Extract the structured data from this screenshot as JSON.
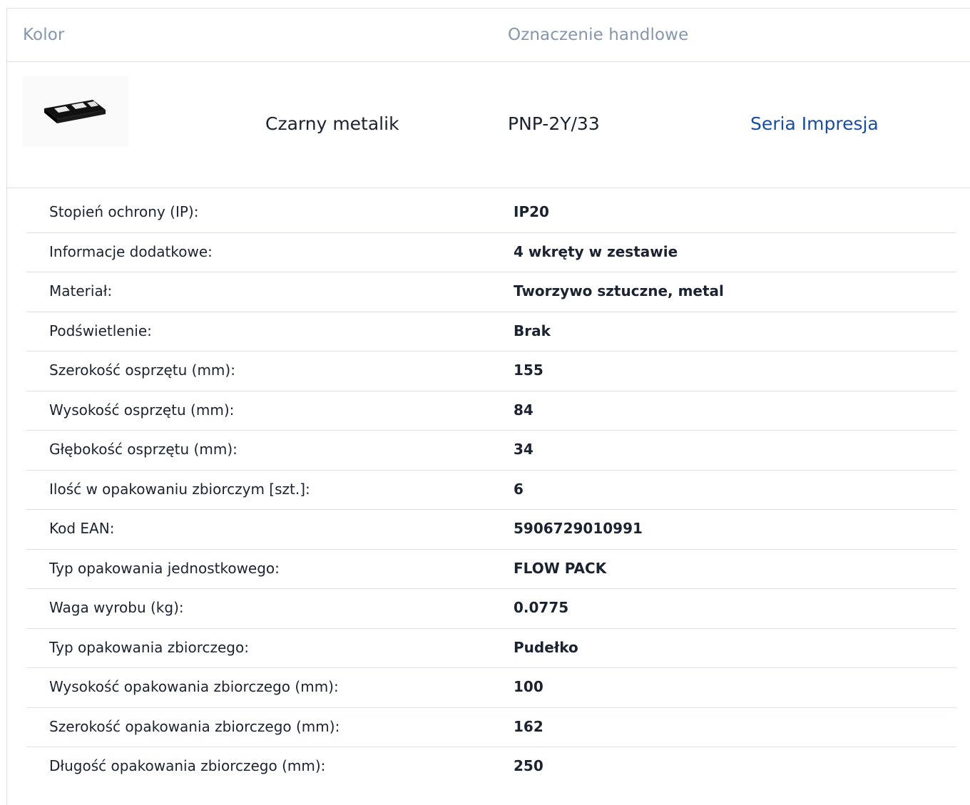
{
  "table": {
    "headers": {
      "color": "Kolor",
      "trade_name": "Oznaczenie handlowe"
    },
    "product": {
      "image_icon": "frame-product-image",
      "color": "Czarny metalik",
      "trade_name": "PNP-2Y/33",
      "series_link": "Seria Impresja"
    }
  },
  "specs": [
    {
      "label": "Stopień ochrony (IP):",
      "value": "IP20"
    },
    {
      "label": "Informacje dodatkowe:",
      "value": "4 wkręty w zestawie"
    },
    {
      "label": "Materiał:",
      "value": "Tworzywo sztuczne, metal"
    },
    {
      "label": "Podświetlenie:",
      "value": "Brak"
    },
    {
      "label": "Szerokość osprzętu (mm):",
      "value": "155"
    },
    {
      "label": "Wysokość osprzętu (mm):",
      "value": "84"
    },
    {
      "label": "Głębokość osprzętu (mm):",
      "value": "34"
    },
    {
      "label": "Ilość w opakowaniu zbiorczym [szt.]:",
      "value": "6"
    },
    {
      "label": "Kod EAN:",
      "value": "5906729010991"
    },
    {
      "label": "Typ opakowania jednostkowego:",
      "value": "FLOW PACK"
    },
    {
      "label": "Waga wyrobu (kg):",
      "value": "0.0775"
    },
    {
      "label": "Typ opakowania zbiorczego:",
      "value": "Pudełko"
    },
    {
      "label": "Wysokość opakowania zbiorczego (mm):",
      "value": "100"
    },
    {
      "label": "Szerokość opakowania zbiorczego (mm):",
      "value": "162"
    },
    {
      "label": "Długość opakowania zbiorczego (mm):",
      "value": "250"
    }
  ],
  "colors": {
    "header_text": "#8597ad",
    "link": "#1a4d9c",
    "body_text": "#1b2230",
    "border": "#dde1e6"
  }
}
